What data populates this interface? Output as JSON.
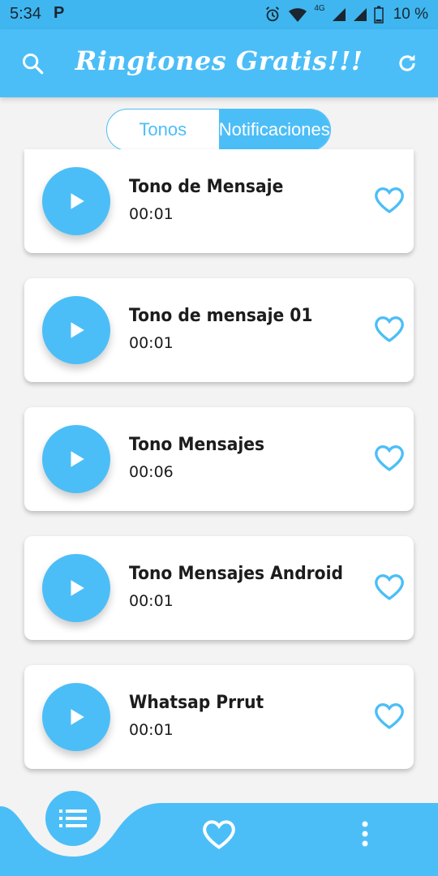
{
  "status_bar": {
    "time": "5:34",
    "carrier_icon": "P",
    "network": "4G",
    "battery_percent": "10 %"
  },
  "app_bar": {
    "title": "Ringtones Gratis!!!",
    "left_icon": "search-icon",
    "right_icon": "refresh-icon"
  },
  "tabs": [
    {
      "label": "Tonos",
      "active": false
    },
    {
      "label": "Notificaciones",
      "active": true
    }
  ],
  "tones": [
    {
      "name": "Tono de Mensaje",
      "duration": "00:01"
    },
    {
      "name": "Tono de mensaje 01",
      "duration": "00:01"
    },
    {
      "name": "Tono Mensajes",
      "duration": "00:06"
    },
    {
      "name": "Tono Mensajes Android",
      "duration": "00:01"
    },
    {
      "name": "Whatsap Prrut",
      "duration": "00:01"
    }
  ],
  "bottom_nav": {
    "items": [
      "list-icon",
      "heart-icon",
      "more-vert-icon"
    ]
  },
  "colors": {
    "accent": "#4cbef7",
    "status_bar": "#3fb6f0",
    "background": "#f3f3f3"
  }
}
